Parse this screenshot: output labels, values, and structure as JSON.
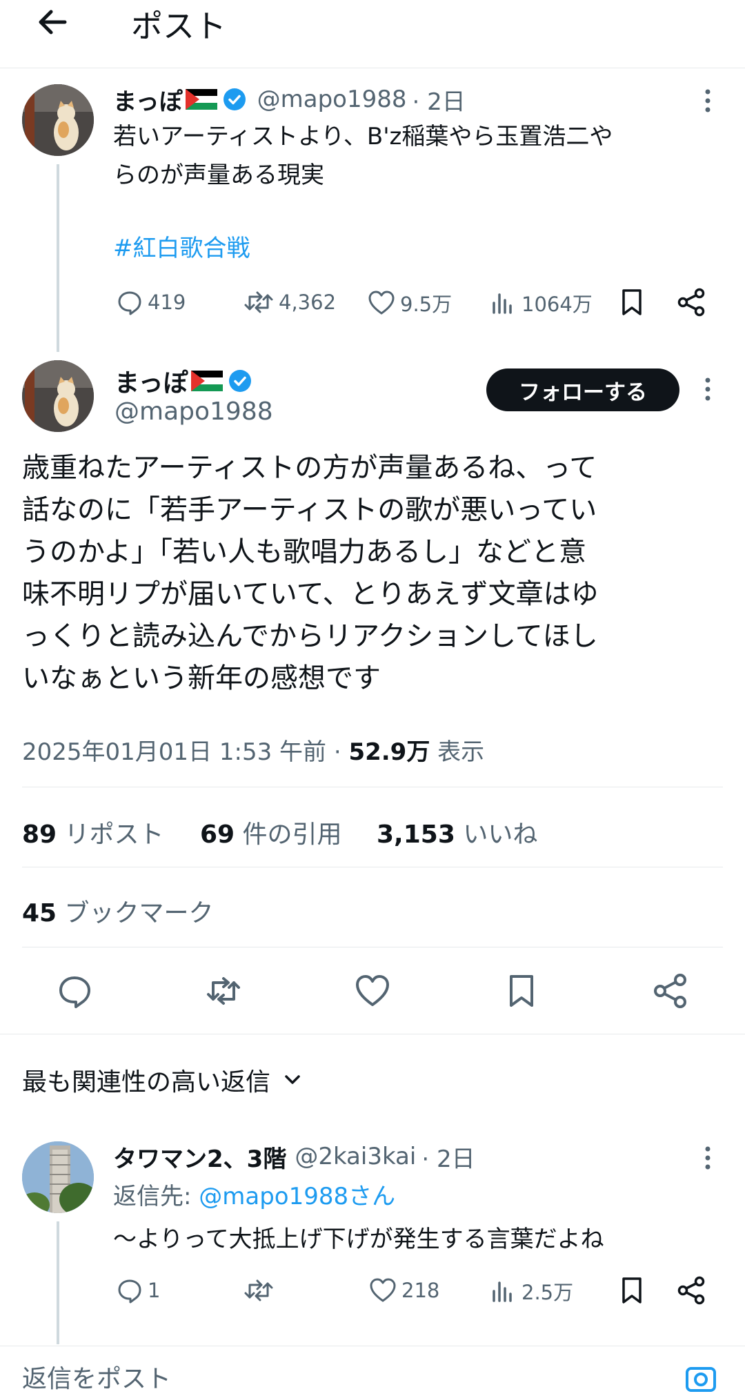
{
  "header": {
    "title": "ポスト"
  },
  "parent_post": {
    "name": "まっぽ",
    "handle": "@mapo1988",
    "time": "· 2日",
    "text": "若いアーティストより、B'z稲葉やら玉置浩二や\nらのが声量ある現実",
    "hashtag": "#紅白歌合戦",
    "replies": "419",
    "reposts": "4,362",
    "likes": "9.5万",
    "views": "1064万"
  },
  "main_post": {
    "name": "まっぽ",
    "handle": "@mapo1988",
    "follow_label": "フォローする",
    "text": "歳重ねたアーティストの方が声量あるね、って\n話なのに「若手アーティストの歌が悪いってい\nうのかよ」「若い人も歌唱力あるし」などと意\n味不明リプが届いていて、とりあえず文章はゆ\nっくりと読み込んでからリアクションしてほし\nいなぁという新年の感想です",
    "datetime": "2025年01月01日 1:53 午前 · ",
    "views_count": "52.9万",
    "views_label": " 表示",
    "reposts_count": "89",
    "reposts_label": " リポスト",
    "quotes_count": "69",
    "quotes_label": " 件の引用",
    "likes_count": "3,153",
    "likes_label": " いいね",
    "bookmarks_count": "45",
    "bookmarks_label": " ブックマーク"
  },
  "replies_section": {
    "sort_label": "最も関連性の高い返信"
  },
  "reply": {
    "name": "タワマン2、3階",
    "handle": "@2kai3kai",
    "time": "· 2日",
    "reply_to_prefix": "返信先: ",
    "reply_to_handle": "@mapo1988さん",
    "text": "〜よりって大抵上げ下げが発生する言葉だよね",
    "replies": "1",
    "likes": "218",
    "views": "2.5万"
  },
  "composer": {
    "placeholder": "返信をポスト"
  },
  "colors": {
    "accent": "#1d9bf0",
    "text": "#0f1419",
    "muted": "#536471",
    "border": "#e6e9eb"
  }
}
